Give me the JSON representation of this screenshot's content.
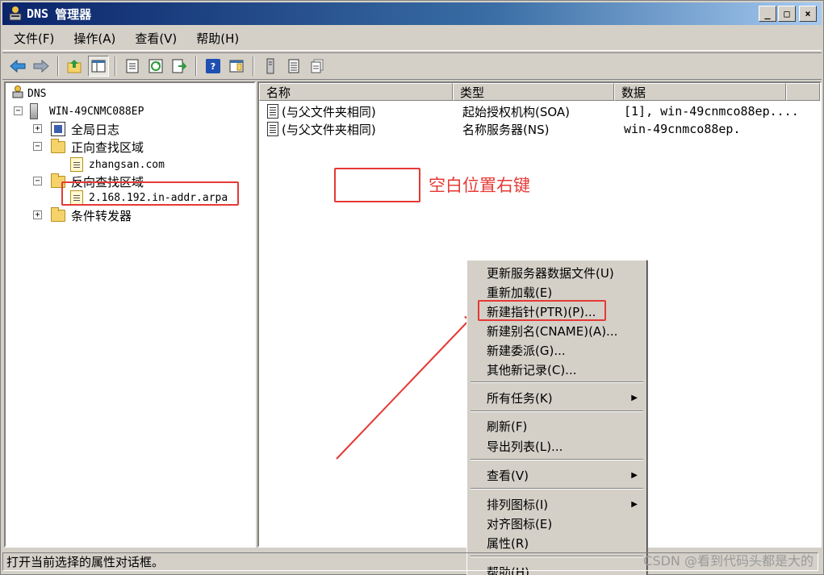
{
  "window": {
    "title_prefix": "DNS",
    "title_suffix": "管理器",
    "buttons": {
      "minimize": "_",
      "maximize": "□",
      "close": "×"
    }
  },
  "menubar": {
    "items": [
      "文件(F)",
      "操作(A)",
      "查看(V)",
      "帮助(H)"
    ]
  },
  "toolbar": {
    "icons": [
      "back-arrow-icon",
      "forward-arrow-icon",
      "up-folder-icon",
      "show-tree-icon",
      "properties-icon",
      "refresh-icon",
      "export-list-icon",
      "help-icon",
      "action-pane-icon",
      "server-icon",
      "zone-icon",
      "record-icon"
    ]
  },
  "tree": {
    "root": "DNS",
    "server": "WIN-49CNMC088EP",
    "global_logs": "全局日志",
    "forward_zones": "正向查找区域",
    "forward_zone_child": "zhangsan.com",
    "reverse_zones": "反向查找区域",
    "reverse_zone_child": "2.168.192.in-addr.arpa",
    "conditional_forwarders": "条件转发器",
    "expander_plus": "+",
    "expander_minus": "−"
  },
  "list": {
    "columns": [
      "名称",
      "类型",
      "数据"
    ],
    "rows": [
      {
        "name": "(与父文件夹相同)",
        "type": "起始授权机构(SOA)",
        "data": "[1], win-49cnmco88ep...."
      },
      {
        "name": "(与父文件夹相同)",
        "type": "名称服务器(NS)",
        "data": "win-49cnmco88ep."
      }
    ]
  },
  "annotation": {
    "text": "空白位置右键",
    "color": "#e53935"
  },
  "context_menu": {
    "items": [
      "更新服务器数据文件(U)",
      "重新加载(E)",
      "新建指针(PTR)(P)...",
      "新建别名(CNAME)(A)...",
      "新建委派(G)...",
      "其他新记录(C)...",
      "所有任务(K)",
      "刷新(F)",
      "导出列表(L)...",
      "查看(V)",
      "排列图标(I)",
      "对齐图标(E)",
      "属性(R)",
      "帮助(H)"
    ],
    "submenu_arrow": "▶"
  },
  "statusbar": {
    "text": "打开当前选择的属性对话框。"
  },
  "watermark": "CSDN @看到代码头都是大的"
}
